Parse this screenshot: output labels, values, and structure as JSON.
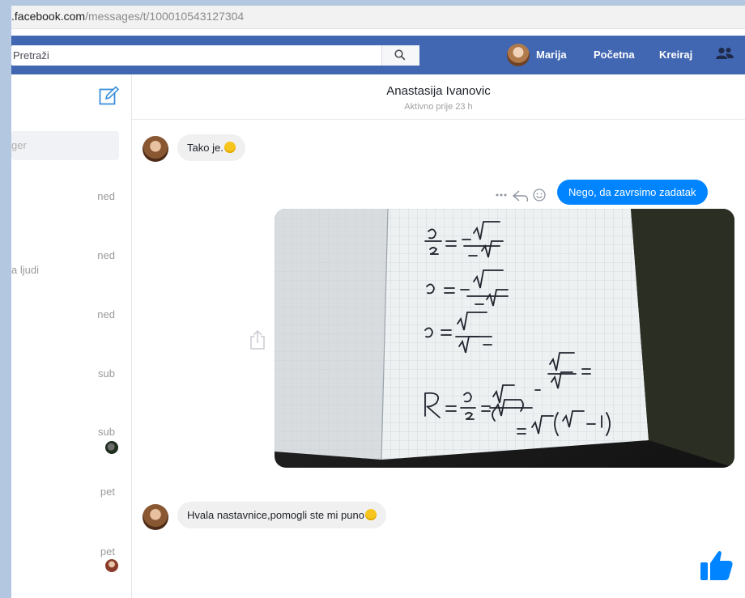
{
  "browser": {
    "url_domain": ".facebook.com",
    "url_path": "/messages/t/100010543127304"
  },
  "topbar": {
    "search_placeholder": "Pretraži",
    "user_name": "Marija",
    "links": [
      "Početna",
      "Kreiraj"
    ],
    "brand_color": "#4267b2"
  },
  "sidebar": {
    "search_fragment": "ger",
    "days": [
      "ned",
      "ned",
      "ned",
      "sub",
      "sub",
      "pet",
      "pet"
    ],
    "snippet": "a ljudi"
  },
  "conversation": {
    "contact_name": "Anastasija Ivanovic",
    "status": "Aktivno prije 23 h",
    "messages": [
      {
        "from": "them",
        "text": "Tako je."
      },
      {
        "from": "me",
        "text": "Nego, da zavrsimo zadatak"
      },
      {
        "from": "me",
        "type": "photo",
        "content": "handwritten math on squared paper"
      },
      {
        "from": "them",
        "text": "Hvala nastavnice,pomogli ste mi puno"
      }
    ],
    "outgoing_color": "#0084ff"
  },
  "icons": [
    "search-icon",
    "compose-icon",
    "friends-icon",
    "more-icon",
    "reply-icon",
    "react-icon",
    "share-icon",
    "like-icon"
  ]
}
